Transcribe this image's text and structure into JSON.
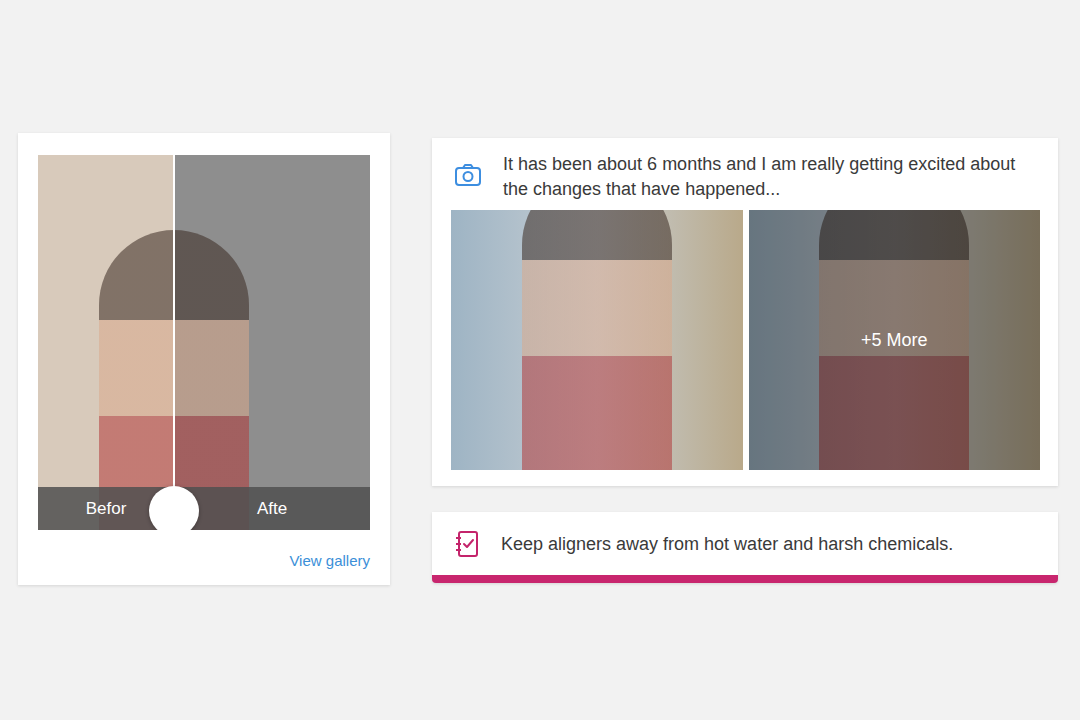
{
  "comparison": {
    "before_label": "Befor",
    "after_label": "Afte",
    "level": 0.41,
    "link": "View gallery"
  },
  "update": {
    "text": "It has been about 6 months and I am really getting excited about the changes that have happened...",
    "photos": [
      {
        "overlay": ""
      },
      {
        "overlay": "+5 More"
      }
    ]
  },
  "tip": {
    "text": "Keep aligners away from hot water and harsh chemicals."
  }
}
